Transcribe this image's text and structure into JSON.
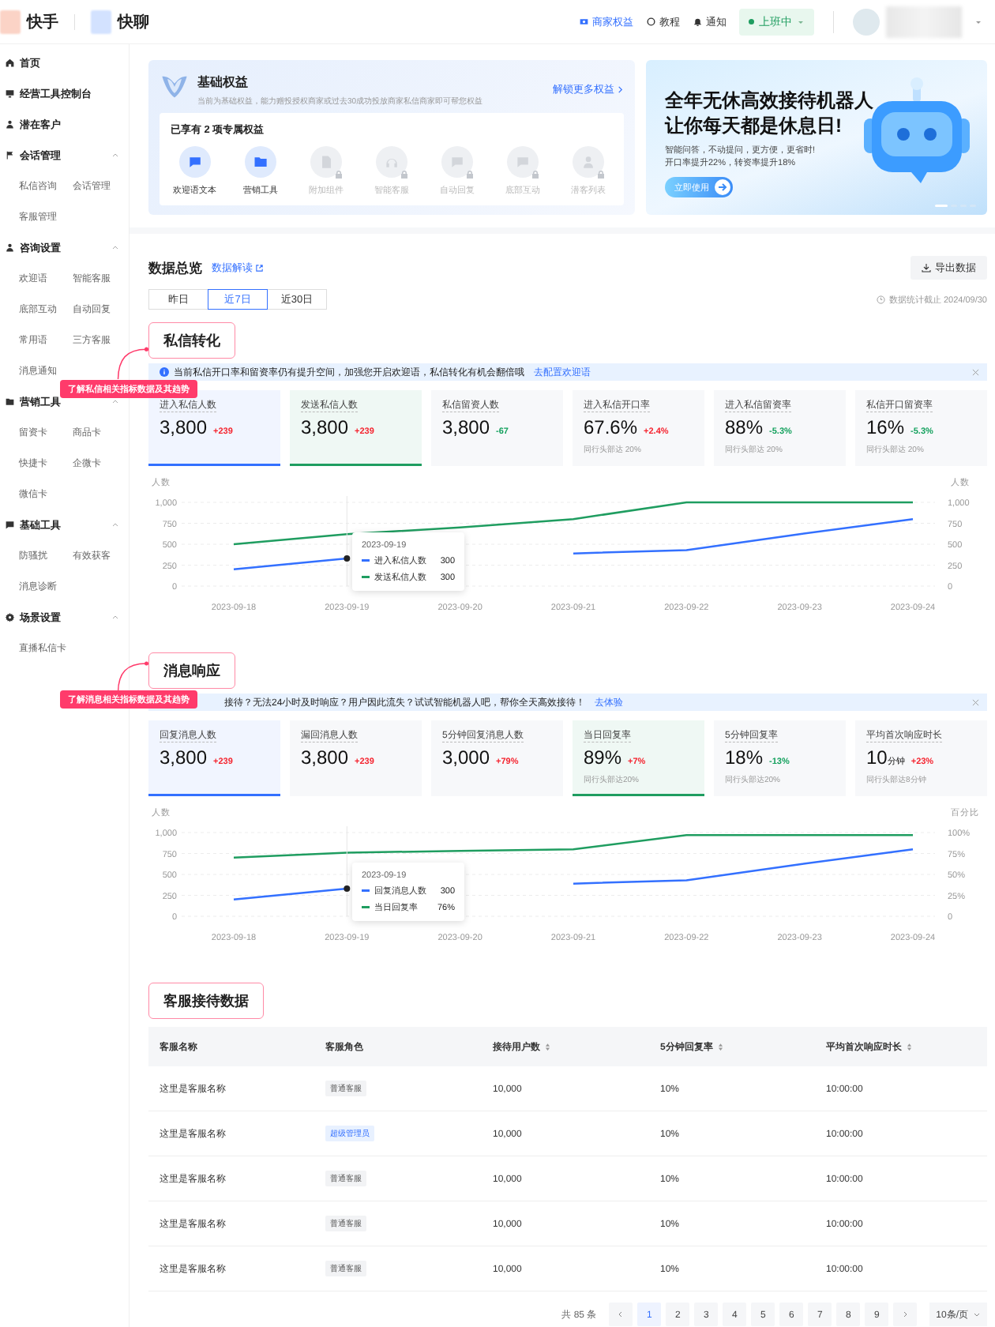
{
  "header": {
    "brands": [
      {
        "name": "快手",
        "color": "#fbd3c6"
      },
      {
        "name": "快聊",
        "color": "#d3e2ff"
      }
    ],
    "links": [
      {
        "label": "商家权益",
        "kind": "benefit"
      },
      {
        "label": "教程",
        "kind": "tutorial"
      },
      {
        "label": "通知",
        "kind": "notice"
      }
    ],
    "status": {
      "label": "上班中",
      "on": true
    }
  },
  "sidebar": {
    "items": [
      {
        "label": "首页"
      },
      {
        "label": "经营工具控制台"
      },
      {
        "label": "潜在客户"
      },
      {
        "label": "会话管理",
        "expanded": true,
        "children": [
          {
            "label": "私信咨询"
          },
          {
            "label": "会话管理"
          },
          {
            "label": "客服管理"
          }
        ]
      },
      {
        "label": "咨询设置",
        "expanded": true,
        "children": [
          {
            "label": "欢迎语"
          },
          {
            "label": "智能客服"
          },
          {
            "label": "底部互动"
          },
          {
            "label": "自动回复"
          },
          {
            "label": "常用语"
          },
          {
            "label": "三方客服"
          },
          {
            "label": "消息通知"
          }
        ]
      },
      {
        "label": "营销工具",
        "expanded": true,
        "children": [
          {
            "label": "留资卡"
          },
          {
            "label": "商品卡"
          },
          {
            "label": "快捷卡"
          },
          {
            "label": "企微卡"
          },
          {
            "label": "微信卡"
          }
        ]
      },
      {
        "label": "基础工具",
        "expanded": true,
        "children": [
          {
            "label": "防骚扰"
          },
          {
            "label": "有效获客"
          },
          {
            "label": "消息诊断"
          }
        ]
      },
      {
        "label": "场景设置",
        "expanded": true,
        "children": [
          {
            "label": "直播私信卡"
          }
        ]
      }
    ]
  },
  "benefits": {
    "title": "基础权益",
    "description": "当前为基础权益，能力赠投授权商家或过去30成功投放商家私信商家即可帮您权益",
    "more_link": "解锁更多权益",
    "owned_label": "已享有 2 项专属权益",
    "items": [
      {
        "label": "欢迎语文本",
        "unlocked": true
      },
      {
        "label": "营销工具",
        "unlocked": true
      },
      {
        "label": "附加组件",
        "unlocked": false
      },
      {
        "label": "智能客服",
        "unlocked": false
      },
      {
        "label": "自动回复",
        "unlocked": false
      },
      {
        "label": "底部互动",
        "unlocked": false
      },
      {
        "label": "潜客列表",
        "unlocked": false
      }
    ]
  },
  "banner": {
    "title_lines": [
      "全年无休高效接待机器人",
      "让你每天都是休息日!"
    ],
    "subtitle_lines": [
      "智能问答，不动提问，更方便，更省时!",
      "开口率提升22%，转资率提升18%"
    ],
    "button": "立即使用",
    "slides": [
      {
        "selected": true
      },
      {
        "selected": false
      },
      {
        "selected": false
      },
      {
        "selected": false
      }
    ]
  },
  "overview": {
    "title": "数据总览",
    "guide_link": "数据解读",
    "export_button": "导出数据",
    "updated": "数据统计截止 2024/09/30",
    "ranges": [
      {
        "label": "昨日",
        "selected": false
      },
      {
        "label": "近7日",
        "selected": true
      },
      {
        "label": "近30日",
        "selected": false
      }
    ]
  },
  "sections": [
    {
      "title": "私信转化",
      "hint": "了解私信相关指标数据及其趋势",
      "notice": {
        "info_icon": true,
        "text": "当前私信开口率和留资率仍有提升空间，加强您开启欢迎语，私信转化有机会翻倍哦",
        "link": "去配置欢迎语"
      },
      "cards": [
        {
          "label": "进入私信人数",
          "value": "3,800",
          "delta": "+239",
          "selected": true,
          "color": "#3370ff"
        },
        {
          "label": "发送私信人数",
          "value": "3,800",
          "delta": "+239",
          "selected": true,
          "color": "#1f9d60"
        },
        {
          "label": "私信留资人数",
          "value": "3,800",
          "delta": "-67",
          "selected": false
        },
        {
          "label": "进入私信开口率",
          "value": "67.6%",
          "delta": "+2.4%",
          "selected": false,
          "benchmark": "同行头部达 20%"
        },
        {
          "label": "进入私信留资率",
          "value": "88%",
          "delta": "-5.3%",
          "selected": false,
          "benchmark": "同行头部达 20%"
        },
        {
          "label": "私信开口留资率",
          "value": "16%",
          "delta": "-5.3%",
          "selected": false,
          "benchmark": "同行头部达 20%"
        }
      ],
      "chart": {
        "tooltip": {
          "title": "2023-09-19",
          "rows": [
            {
              "value": "300"
            },
            {
              "value": "300"
            }
          ]
        },
        "chart_data": {
          "type": "line",
          "grid": true,
          "legend": "lower left",
          "ylabel": "人数",
          "y2label": "人数",
          "categories": [
            "2023-09-18",
            "2023-09-19",
            "2023-09-20",
            "2023-09-21",
            "2023-09-22",
            "2023-09-23",
            "2023-09-24"
          ],
          "ylim": [
            0,
            1000
          ],
          "yticks": [
            0,
            250,
            500,
            750,
            {
              "value": 1000,
              "label": "1,000"
            }
          ],
          "y2lim": [
            0,
            1000
          ],
          "y2ticks": [
            0,
            250,
            500,
            750,
            {
              "value": 1000,
              "label": "1,000"
            }
          ],
          "ref_lines": [
            {
              "axis": "x",
              "value": "2023-09-19"
            }
          ],
          "series": [
            {
              "name": "进入私信人数",
              "color": "#3370ff",
              "values": [
                200,
                330,
                null,
                390,
                430,
                620,
                800
              ]
            },
            {
              "name": "发送私信人数",
              "color": "#1f9d60",
              "values": [
                500,
                620,
                700,
                800,
                1000,
                1000,
                1000
              ]
            }
          ]
        }
      }
    },
    {
      "title": "消息响应",
      "hint": "了解消息相关指标数据及其趋势",
      "notice": {
        "info_icon": false,
        "text": "接待？无法24小时及时响应？用户因此流失？试试智能机器人吧，帮你全天高效接待！",
        "link": "去体验"
      },
      "cards": [
        {
          "label": "回复消息人数",
          "value": "3,800",
          "delta": "+239",
          "selected": true,
          "color": "#3370ff"
        },
        {
          "label": "漏回消息人数",
          "value": "3,800",
          "delta": "+239",
          "selected": false
        },
        {
          "label": "5分钟回复消息人数",
          "value": "3,000",
          "delta": "+79%",
          "selected": false
        },
        {
          "label": "当日回复率",
          "value": "89%",
          "delta": "+7%",
          "selected": true,
          "color": "#1f9d60",
          "benchmark": "同行头部达20%"
        },
        {
          "label": "5分钟回复率",
          "value": "18%",
          "delta": "-13%",
          "selected": false,
          "benchmark": "同行头部达20%"
        },
        {
          "label": "平均首次响应时长",
          "value": "10",
          "unit": "分钟",
          "delta": "+23%",
          "selected": false,
          "benchmark": "同行头部达8分钟"
        }
      ],
      "chart": {
        "tooltip": {
          "title": "2023-09-19",
          "rows": [
            {
              "value": "300"
            },
            {
              "value": "76%"
            }
          ]
        },
        "chart_data": {
          "type": "line",
          "grid": true,
          "legend": "lower left",
          "ylabel": "人数",
          "y2label": "百分比",
          "categories": [
            "2023-09-18",
            "2023-09-19",
            "2023-09-20",
            "2023-09-21",
            "2023-09-22",
            "2023-09-23",
            "2023-09-24"
          ],
          "ylim": [
            0,
            1000
          ],
          "yticks": [
            0,
            250,
            500,
            750,
            {
              "value": 1000,
              "label": "1,000"
            }
          ],
          "y2lim": [
            0,
            100
          ],
          "y2ticks": [
            0,
            {
              "value": 25,
              "label": "25%"
            },
            {
              "value": 50,
              "label": "50%"
            },
            {
              "value": 75,
              "label": "75%"
            },
            {
              "value": 100,
              "label": "100%"
            }
          ],
          "ref_lines": [
            {
              "axis": "x",
              "value": "2023-09-19"
            }
          ],
          "series": [
            {
              "name": "回复消息人数",
              "color": "#3370ff",
              "values": [
                200,
                330,
                null,
                390,
                430,
                620,
                800
              ]
            },
            {
              "name": "当日回复率",
              "color": "#1f9d60",
              "axis": "y2",
              "values": [
                70,
                76,
                78,
                80,
                97,
                97,
                97
              ]
            }
          ]
        }
      }
    }
  ],
  "table": {
    "title": "客服接待数据",
    "columns": [
      {
        "label": "客服名称",
        "sortable": false
      },
      {
        "label": "客服角色",
        "sortable": false
      },
      {
        "label": "接待用户数",
        "sortable": true
      },
      {
        "label": "5分钟回复率",
        "sortable": true
      },
      {
        "label": "平均首次响应时长",
        "sortable": true
      }
    ],
    "rows": [
      {
        "name": "这里是客服名称",
        "role": {
          "label": "普通客服",
          "kind": "normal"
        },
        "users": "10,000",
        "rate": "10%",
        "duration": "10:00:00"
      },
      {
        "name": "这里是客服名称",
        "role": {
          "label": "超级管理员",
          "kind": "admin"
        },
        "users": "10,000",
        "rate": "10%",
        "duration": "10:00:00"
      },
      {
        "name": "这里是客服名称",
        "role": {
          "label": "普通客服",
          "kind": "normal"
        },
        "users": "10,000",
        "rate": "10%",
        "duration": "10:00:00"
      },
      {
        "name": "这里是客服名称",
        "role": {
          "label": "普通客服",
          "kind": "normal"
        },
        "users": "10,000",
        "rate": "10%",
        "duration": "10:00:00"
      },
      {
        "name": "这里是客服名称",
        "role": {
          "label": "普通客服",
          "kind": "normal"
        },
        "users": "10,000",
        "rate": "10%",
        "duration": "10:00:00"
      }
    ]
  },
  "pagination": {
    "total": "共 85 条",
    "page_size": "10条/页",
    "pages": [
      {
        "label": "1",
        "selected": true
      },
      {
        "label": "2",
        "selected": false
      },
      {
        "label": "3",
        "selected": false
      },
      {
        "label": "4",
        "selected": false
      },
      {
        "label": "5",
        "selected": false
      },
      {
        "label": "6",
        "selected": false
      },
      {
        "label": "7",
        "selected": false
      },
      {
        "label": "8",
        "selected": false
      },
      {
        "label": "9",
        "selected": false
      }
    ]
  }
}
